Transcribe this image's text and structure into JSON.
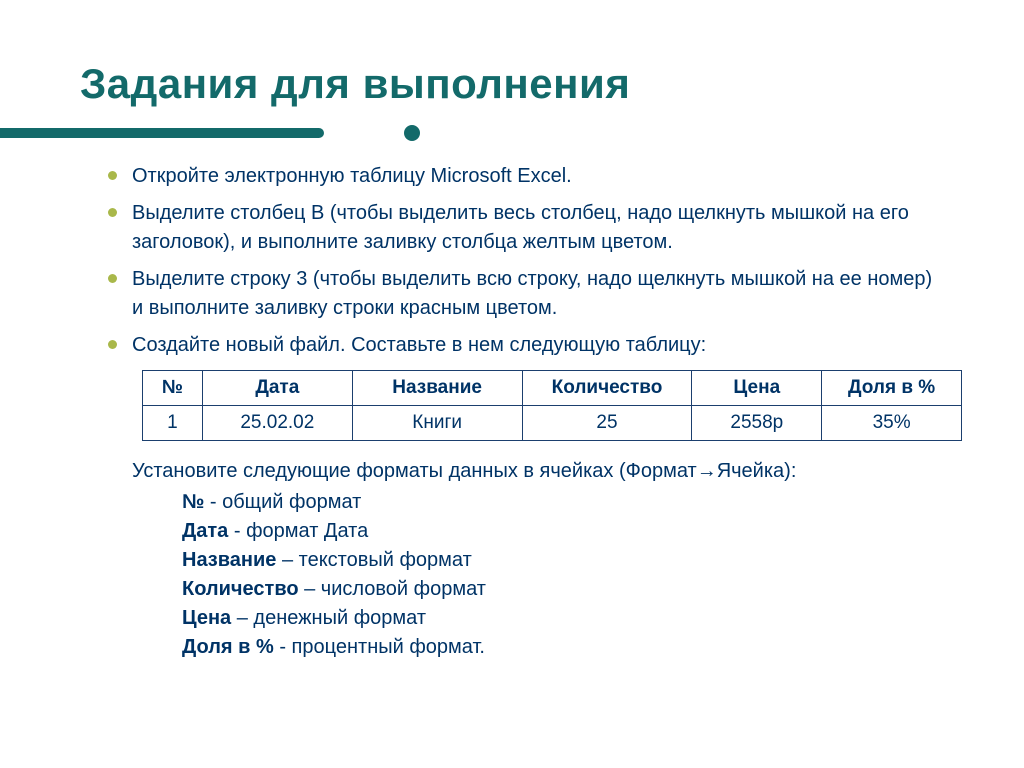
{
  "title": "Задания для выполнения",
  "bullets": [
    "Откройте электронную таблицу Microsoft Excel.",
    "Выделите столбец В (чтобы выделить весь столбец, надо щелкнуть мышкой на его заголовок), и выполните заливку столбца желтым цветом.",
    "Выделите строку 3 (чтобы выделить всю строку, надо щелкнуть мышкой на ее номер) и выполните заливку строки красным цветом.",
    "Создайте новый файл. Составьте в нем следующую таблицу:"
  ],
  "table": {
    "headers": [
      "№",
      "Дата",
      "Название",
      "Количество",
      "Цена",
      "Доля в %"
    ],
    "row": [
      "1",
      "25.02.02",
      "Книги",
      "25",
      "2558р",
      "35%"
    ]
  },
  "note_prefix": "Установите следующие форматы данных в  ячейках (Формат",
  "note_arrow": "→",
  "note_suffix": "Ячейка):",
  "formats": [
    {
      "label": "№",
      "desc": " - общий формат"
    },
    {
      "label": "Дата",
      "desc": " -  формат Дата"
    },
    {
      "label": "Название",
      "desc": " – текстовый формат"
    },
    {
      "label": "Количество",
      "desc": " – числовой формат"
    },
    {
      "label": "Цена",
      "desc": " – денежный формат"
    },
    {
      "label": "Доля в %",
      "desc": "  - процентный формат."
    }
  ]
}
